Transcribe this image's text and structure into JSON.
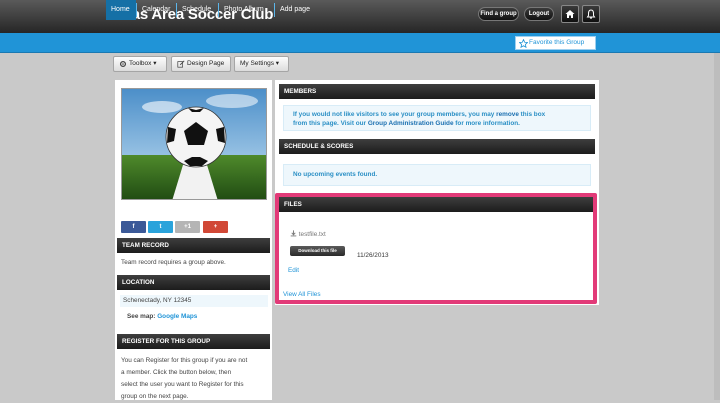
{
  "header": {
    "site_title": "Dallas Area Soccer Club",
    "find_group": "Find a group",
    "logout": "Logout"
  },
  "nav": {
    "items": [
      "Home",
      "Calendar",
      "Schedule",
      "Photo Album",
      "Add page"
    ],
    "favorite": "Favorite this Group"
  },
  "toolbar": {
    "toolbox": "Toolbox",
    "design_page": "Design Page",
    "my_settings": "My Settings"
  },
  "sidebar": {
    "share": {
      "facebook": "f",
      "twitter": "t",
      "google": "+1",
      "more": "+"
    },
    "team_record": {
      "title": "TEAM RECORD",
      "text": "Team record requires a group above."
    },
    "location": {
      "title": "LOCATION",
      "address": "Schenectady, NY 12345",
      "see_map_label": "See map:",
      "map_link": "Google Maps"
    },
    "register": {
      "title": "REGISTER FOR THIS GROUP",
      "lines": [
        "You can Register for this group if you are not",
        "a member. Click the button below, then",
        "select the user you want to Register for this",
        "group on the next page."
      ]
    }
  },
  "members": {
    "title": "MEMBERS",
    "text_1": "If you would not like visitors to see your group members, you may",
    "link_1": "remove",
    "text_2": "this box",
    "text_3": "from this page. Visit our",
    "link_2": "Group Administration Guide",
    "text_4": "for more information."
  },
  "schedule": {
    "title": "SCHEDULE & SCORES",
    "empty": "No upcoming events found."
  },
  "files": {
    "title": "FILES",
    "file_name": "testfile.txt",
    "download_label": "Download this file",
    "date": "11/26/2013",
    "edit": "Edit",
    "view_all": "View All Files"
  },
  "colors": {
    "nav_blue": "#2094d7",
    "highlight": "#e23a78",
    "header_dark": "#262626"
  }
}
